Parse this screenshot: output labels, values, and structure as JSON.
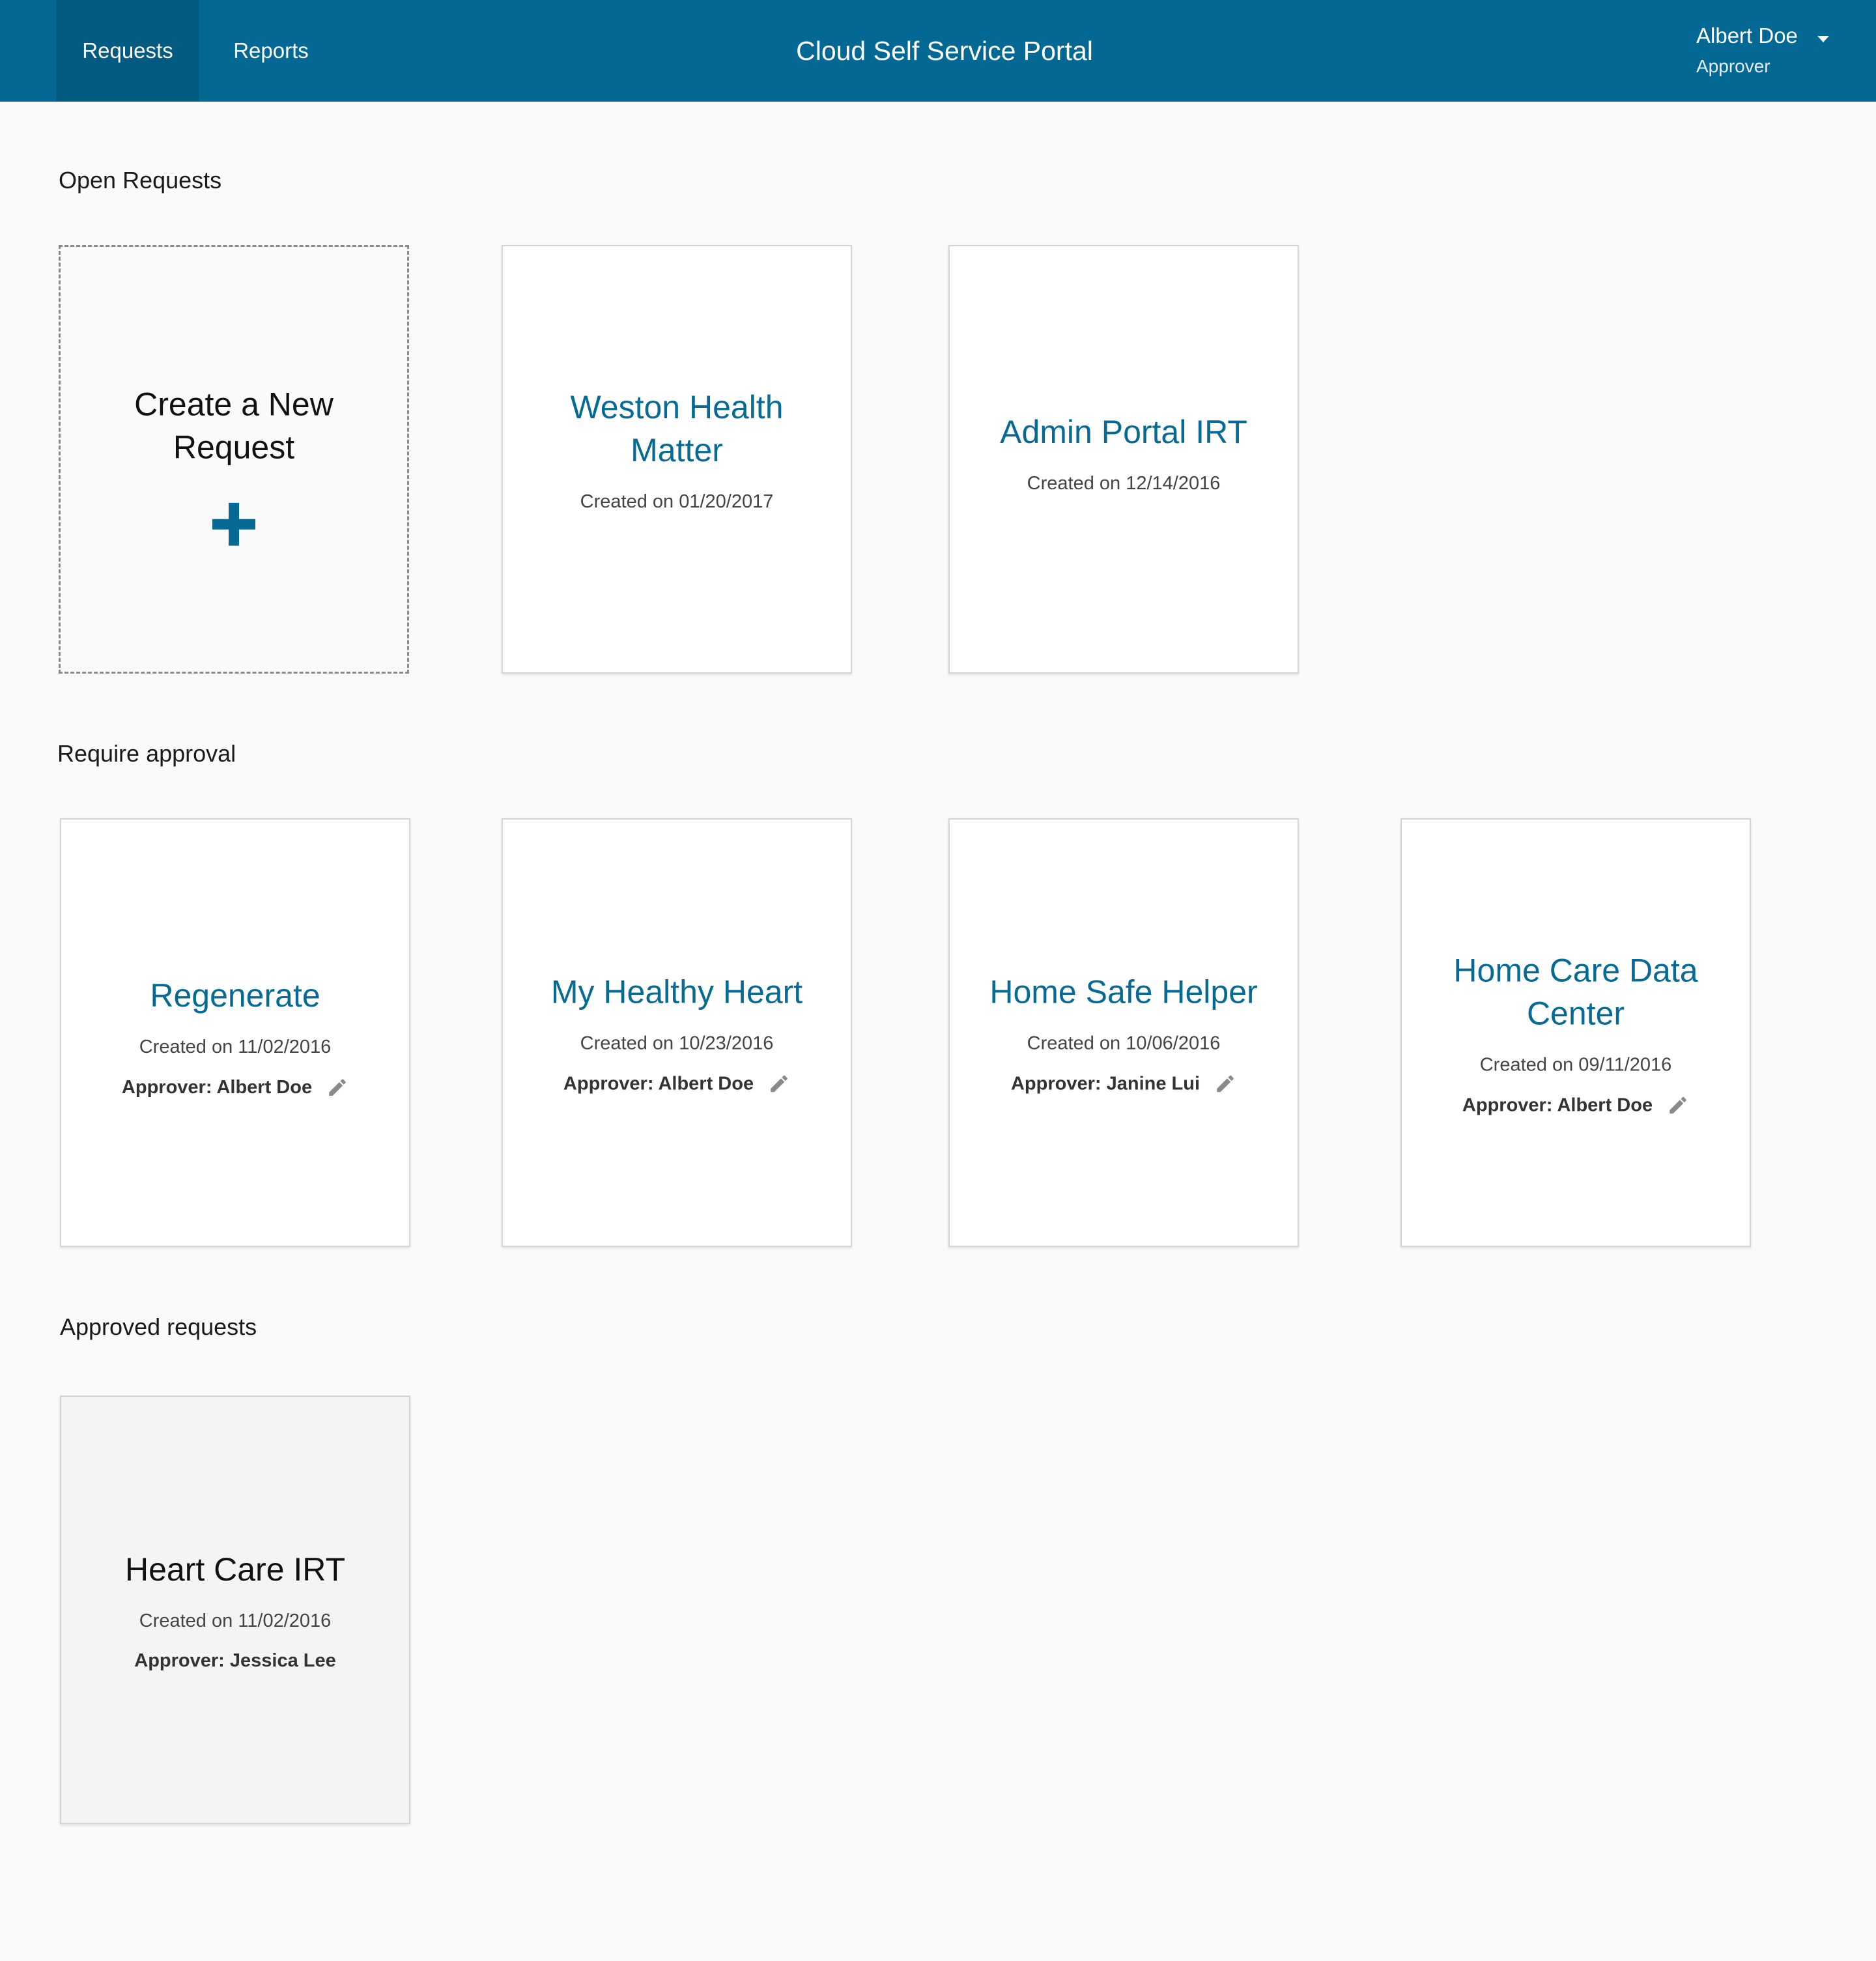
{
  "header": {
    "tabs": [
      {
        "label": "Requests",
        "active": true
      },
      {
        "label": "Reports",
        "active": false
      }
    ],
    "title": "Cloud Self Service Portal",
    "user": {
      "name": "Albert Doe",
      "role": "Approver"
    }
  },
  "colors": {
    "brand": "#046894",
    "accent_text": "#076a94"
  },
  "sections": {
    "open": {
      "title": "Open Requests",
      "new_card": {
        "title": "Create a New Request",
        "icon": "plus-icon"
      },
      "cards": [
        {
          "title": "Weston Health Matter",
          "date": "Created on 01/20/2017"
        },
        {
          "title": "Admin Portal IRT",
          "date": "Created on 12/14/2016"
        }
      ]
    },
    "approval": {
      "title": "Require approval",
      "cards": [
        {
          "title": "Regenerate",
          "date": "Created on 11/02/2016",
          "approver": "Approver: Albert Doe",
          "icon": "pencil-icon"
        },
        {
          "title": "My Healthy Heart",
          "date": "Created on 10/23/2016",
          "approver": "Approver: Albert Doe",
          "icon": "pencil-icon"
        },
        {
          "title": "Home Safe Helper",
          "date": "Created on 10/06/2016",
          "approver": "Approver: Janine Lui",
          "icon": "pencil-icon"
        },
        {
          "title": "Home Care Data Center",
          "date": "Created on 09/11/2016",
          "approver": "Approver: Albert Doe",
          "icon": "pencil-icon"
        }
      ]
    },
    "approved": {
      "title": "Approved requests",
      "cards": [
        {
          "title": "Heart Care IRT",
          "date": "Created on 11/02/2016",
          "approver": "Approver: Jessica Lee"
        }
      ]
    }
  }
}
